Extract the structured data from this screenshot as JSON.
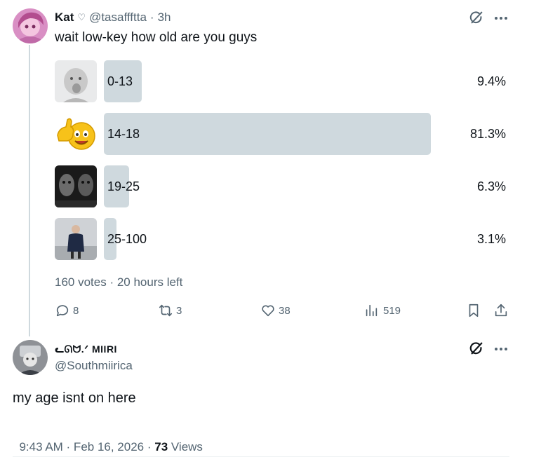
{
  "tweet": {
    "author_name": "Kat",
    "author_badge": "♡",
    "handle": "@tasaffftta",
    "separator": "·",
    "time": "3h",
    "text": "wait low-key how old are you guys",
    "poll": {
      "options": [
        {
          "label": "0-13",
          "percent_text": "9.4%",
          "percent": 9.4,
          "thumb": "baby-photo"
        },
        {
          "label": "14-18",
          "percent_text": "81.3%",
          "percent": 81.3,
          "thumb": "thumbs-up-emoji"
        },
        {
          "label": "19-25",
          "percent_text": "6.3%",
          "percent": 6.3,
          "thumb": "dark-faces-photo"
        },
        {
          "label": "25-100",
          "percent_text": "3.1%",
          "percent": 3.1,
          "thumb": "person-photo"
        }
      ],
      "summary": "160 votes · 20 hours left"
    },
    "actions": {
      "replies": "8",
      "reposts": "3",
      "likes": "38",
      "views": "519"
    }
  },
  "reply": {
    "author_name": "ᓚᘏᗢ.ᐟ MIIRI",
    "handle": "@Southmiirica",
    "text": "my age isnt on here",
    "timestamp": "9:43 AM · Feb 16, 2026 · ",
    "views_count": "73",
    "views_label": " Views"
  },
  "colors": {
    "text": "#0f1419",
    "muted": "#536471",
    "poll_bar": "#cfd9de",
    "thread_line": "#cfd9de"
  }
}
